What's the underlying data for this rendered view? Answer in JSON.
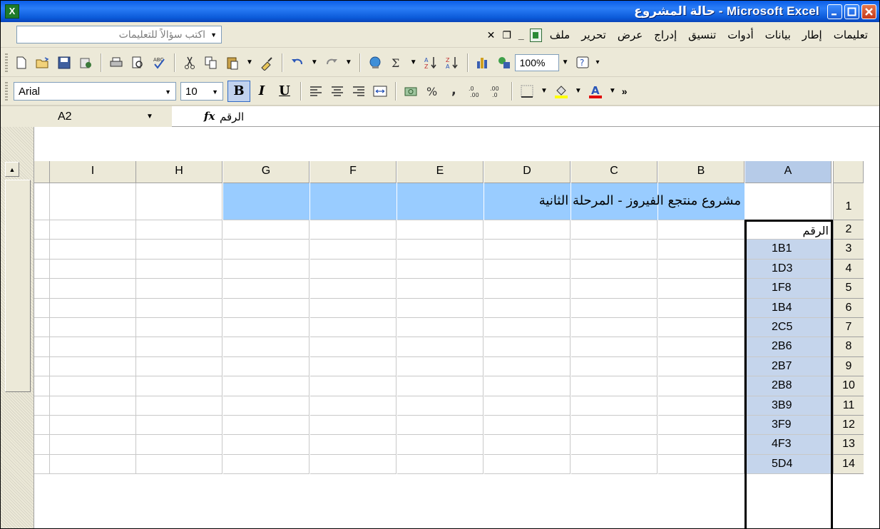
{
  "window": {
    "title": "Microsoft Excel - حالة المشروع",
    "app_icon": "excel-icon"
  },
  "menubar": {
    "items": [
      "ملف",
      "تحرير",
      "عرض",
      "إدراج",
      "تنسيق",
      "أدوات",
      "بيانات",
      "إطار",
      "تعليمات"
    ],
    "help_placeholder": "اكتب سؤالاً للتعليمات"
  },
  "toolbar": {
    "zoom": "100%",
    "font": "Arial",
    "font_size": "10"
  },
  "formula_bar": {
    "name_box": "A2",
    "fx_label": "fx",
    "content": "الرقم"
  },
  "sheet": {
    "columns": [
      "I",
      "H",
      "G",
      "F",
      "E",
      "D",
      "C",
      "B",
      "A"
    ],
    "selected_column": "A",
    "rows": [
      {
        "num": "1",
        "a": ""
      },
      {
        "num": "2",
        "a": "الرقم"
      },
      {
        "num": "3",
        "a": "1B1"
      },
      {
        "num": "4",
        "a": "1D3"
      },
      {
        "num": "5",
        "a": "1F8"
      },
      {
        "num": "6",
        "a": "1B4"
      },
      {
        "num": "7",
        "a": "2C5"
      },
      {
        "num": "8",
        "a": "2B6"
      },
      {
        "num": "9",
        "a": "2B7"
      },
      {
        "num": "10",
        "a": "2B8"
      },
      {
        "num": "11",
        "a": "3B9"
      },
      {
        "num": "12",
        "a": "3F9"
      },
      {
        "num": "13",
        "a": "4F3"
      },
      {
        "num": "14",
        "a": "5D4"
      }
    ],
    "title_text": "مشروع منتجع الفيروز  -  المرحلة الثانية",
    "title_fill": "#99ccff",
    "selection_fill": "#c5d5ec"
  }
}
